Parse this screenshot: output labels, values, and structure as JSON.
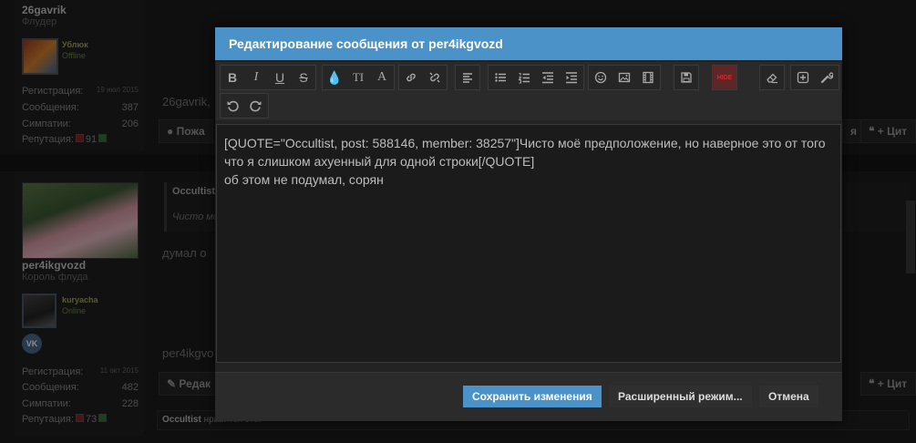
{
  "background": {
    "post1": {
      "username": "26gavrik",
      "user_title": "Флудер",
      "friend_name": "Ублюк",
      "friend_status": "Offline",
      "stats": [
        {
          "label": "Регистрация:",
          "value": "19 июл 2015"
        },
        {
          "label": "Сообщения:",
          "value": "387"
        },
        {
          "label": "Симпатии:",
          "value": "206"
        }
      ],
      "reputation_label": "Репутация:",
      "reputation_value": "91",
      "post_text": "26gavrik,",
      "report_button": "Пожа",
      "reply_button": "+ Цит",
      "like_button": "я"
    },
    "post2": {
      "username": "per4ikgvozd",
      "user_title": "Король флуда",
      "friend_name": "kuryacha",
      "friend_status": "Online",
      "vk_label": "VK",
      "stats": [
        {
          "label": "Регистрация:",
          "value": "11 окт 2015"
        },
        {
          "label": "Сообщения:",
          "value": "482"
        },
        {
          "label": "Симпатии:",
          "value": "228"
        }
      ],
      "reputation_label": "Репутация:",
      "reputation_value": "73",
      "quote_author": "Occultist",
      "quote_preview": "Чисто мо",
      "post_text": "думал о",
      "signature": "per4ikgvo",
      "edit_button": "Редак",
      "reply_button": "+ Цит",
      "liked_user": "Occultist",
      "liked_text": " нравится это."
    }
  },
  "modal": {
    "title": "Редактирование сообщения от per4ikgvozd",
    "toolbar": {
      "bold": "B",
      "italic": "I",
      "underline": "U",
      "strike": "S",
      "font_size": "TI",
      "font_family": "A",
      "hide_label": "HIDE"
    },
    "editor_text": "[QUOTE=\"Occultist, post: 588146, member: 38257\"]Чисто моё предположение, но наверное это от того что я слишком ахуенный для одной строки[/QUOTE]\nоб этом не подумал, сорян",
    "buttons": {
      "save": "Сохранить изменения",
      "advanced": "Расширенный режим...",
      "cancel": "Отмена"
    }
  },
  "colors": {
    "accent": "#4b92c8",
    "background": "#1c1c1c"
  }
}
